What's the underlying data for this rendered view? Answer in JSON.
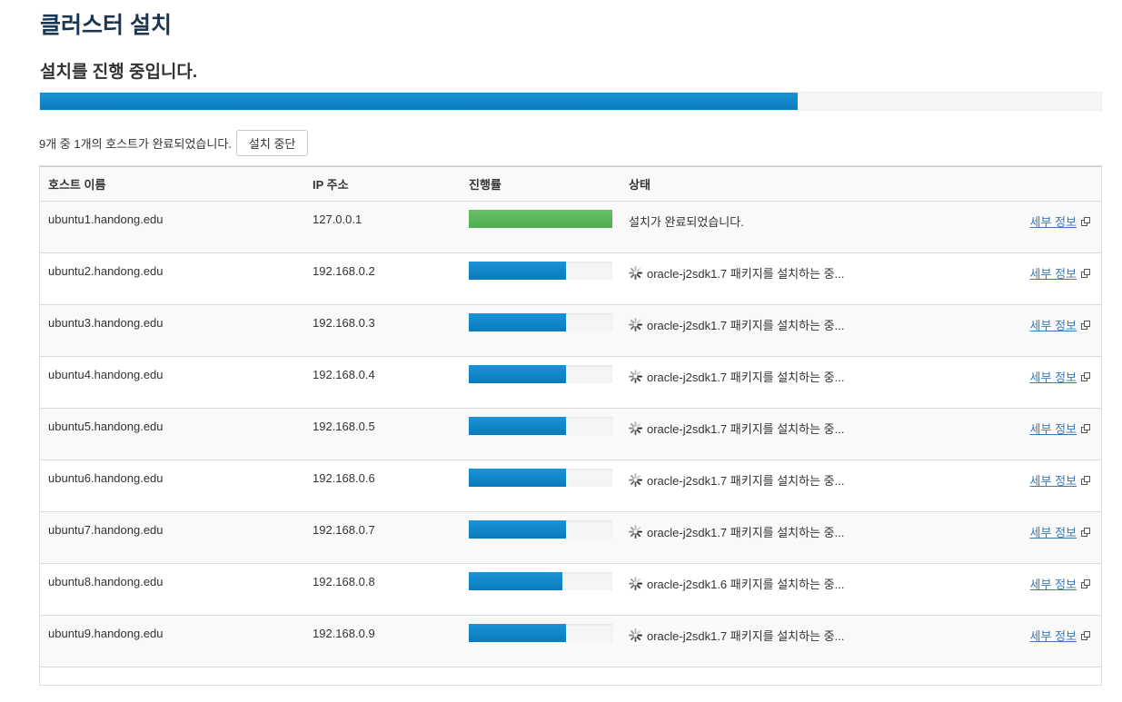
{
  "page": {
    "title": "클러스터 설치",
    "subtitle": "설치를 진행 중입니다."
  },
  "overall_progress": {
    "percent": 71.4
  },
  "summary": {
    "text": "9개 중 1개의 호스트가 완료되었습니다.",
    "stop_button_label": "설치 중단"
  },
  "table": {
    "headers": {
      "host": "호스트 이름",
      "ip": "IP 주소",
      "progress": "진행률",
      "status": "상태"
    },
    "detail_link_label": "세부 정보",
    "rows": [
      {
        "host": "ubuntu1.handong.edu",
        "ip": "127.0.0.1",
        "progress": 100,
        "state": "done",
        "status": "설치가 완료되었습니다."
      },
      {
        "host": "ubuntu2.handong.edu",
        "ip": "192.168.0.2",
        "progress": 68,
        "state": "running",
        "status": "oracle-j2sdk1.7 패키지를 설치하는 중..."
      },
      {
        "host": "ubuntu3.handong.edu",
        "ip": "192.168.0.3",
        "progress": 68,
        "state": "running",
        "status": "oracle-j2sdk1.7 패키지를 설치하는 중..."
      },
      {
        "host": "ubuntu4.handong.edu",
        "ip": "192.168.0.4",
        "progress": 68,
        "state": "running",
        "status": "oracle-j2sdk1.7 패키지를 설치하는 중..."
      },
      {
        "host": "ubuntu5.handong.edu",
        "ip": "192.168.0.5",
        "progress": 68,
        "state": "running",
        "status": "oracle-j2sdk1.7 패키지를 설치하는 중..."
      },
      {
        "host": "ubuntu6.handong.edu",
        "ip": "192.168.0.6",
        "progress": 68,
        "state": "running",
        "status": "oracle-j2sdk1.7 패키지를 설치하는 중..."
      },
      {
        "host": "ubuntu7.handong.edu",
        "ip": "192.168.0.7",
        "progress": 68,
        "state": "running",
        "status": "oracle-j2sdk1.7 패키지를 설치하는 중..."
      },
      {
        "host": "ubuntu8.handong.edu",
        "ip": "192.168.0.8",
        "progress": 65,
        "state": "running",
        "status": "oracle-j2sdk1.6 패키지를 설치하는 중..."
      },
      {
        "host": "ubuntu9.handong.edu",
        "ip": "192.168.0.9",
        "progress": 68,
        "state": "running",
        "status": "oracle-j2sdk1.7 패키지를 설치하는 중..."
      }
    ]
  },
  "icons": {
    "spinner": "spinner-icon",
    "popout": "external-window-icon"
  },
  "colors": {
    "progress_blue": "#0a7bbd",
    "progress_green": "#5cb85c",
    "link": "#3a79b8",
    "title": "#1d3650"
  }
}
